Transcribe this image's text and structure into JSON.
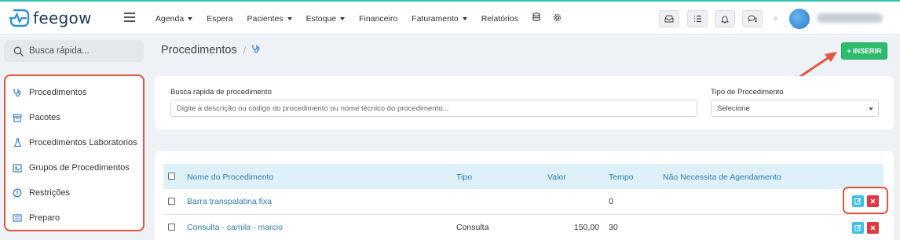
{
  "app": {
    "logo_text": "feegow",
    "brand_color": "#1d3a5c",
    "accent_color": "#2ec4b6"
  },
  "topbar": {
    "nav": [
      {
        "label": "Agenda",
        "has_caret": true
      },
      {
        "label": "Espera",
        "has_caret": false
      },
      {
        "label": "Pacientes",
        "has_caret": true
      },
      {
        "label": "Estoque",
        "has_caret": true
      },
      {
        "label": "Financeiro",
        "has_caret": false
      },
      {
        "label": "Faturamento",
        "has_caret": true
      },
      {
        "label": "Relatórios",
        "has_caret": false
      }
    ],
    "nav_icons": [
      "database-icon",
      "gear-icon"
    ],
    "right_buttons": [
      "inbox-icon",
      "task-list-icon",
      "bell-icon",
      "chat-icon"
    ]
  },
  "search": {
    "placeholder": "Busca rápida..."
  },
  "sidebar": {
    "items": [
      {
        "label": "Procedimentos",
        "icon": "stethoscope-icon"
      },
      {
        "label": "Pacotes",
        "icon": "package-icon"
      },
      {
        "label": "Procedimentos Laboratorios",
        "icon": "flask-icon"
      },
      {
        "label": "Grupos de Procedimentos",
        "icon": "group-icon"
      },
      {
        "label": "Restrições",
        "icon": "alert-circle-icon"
      },
      {
        "label": "Preparo",
        "icon": "list-icon"
      }
    ]
  },
  "page": {
    "title": "Procedimentos",
    "insert_label": "+ INSERIR",
    "insert_color": "#2dbb6c"
  },
  "filters": {
    "search_label": "Busca rápida de procedimento",
    "search_placeholder": "Digite a descrição ou código do procedimento ou nome técnico do procedimento...",
    "type_label": "Tipo de Procedimento",
    "type_selected": "Selecione"
  },
  "table": {
    "headers": [
      "Nome do Procedimento",
      "Tipo",
      "Valor",
      "Tempo",
      "Não Necessita de Agendamento"
    ],
    "rows": [
      {
        "name": "Barra transpalatina fixa",
        "type": "",
        "value": "",
        "time": "0"
      },
      {
        "name": "Consulta - camila - marcio",
        "type": "Consulta",
        "value": "150,00",
        "time": "30"
      }
    ]
  }
}
